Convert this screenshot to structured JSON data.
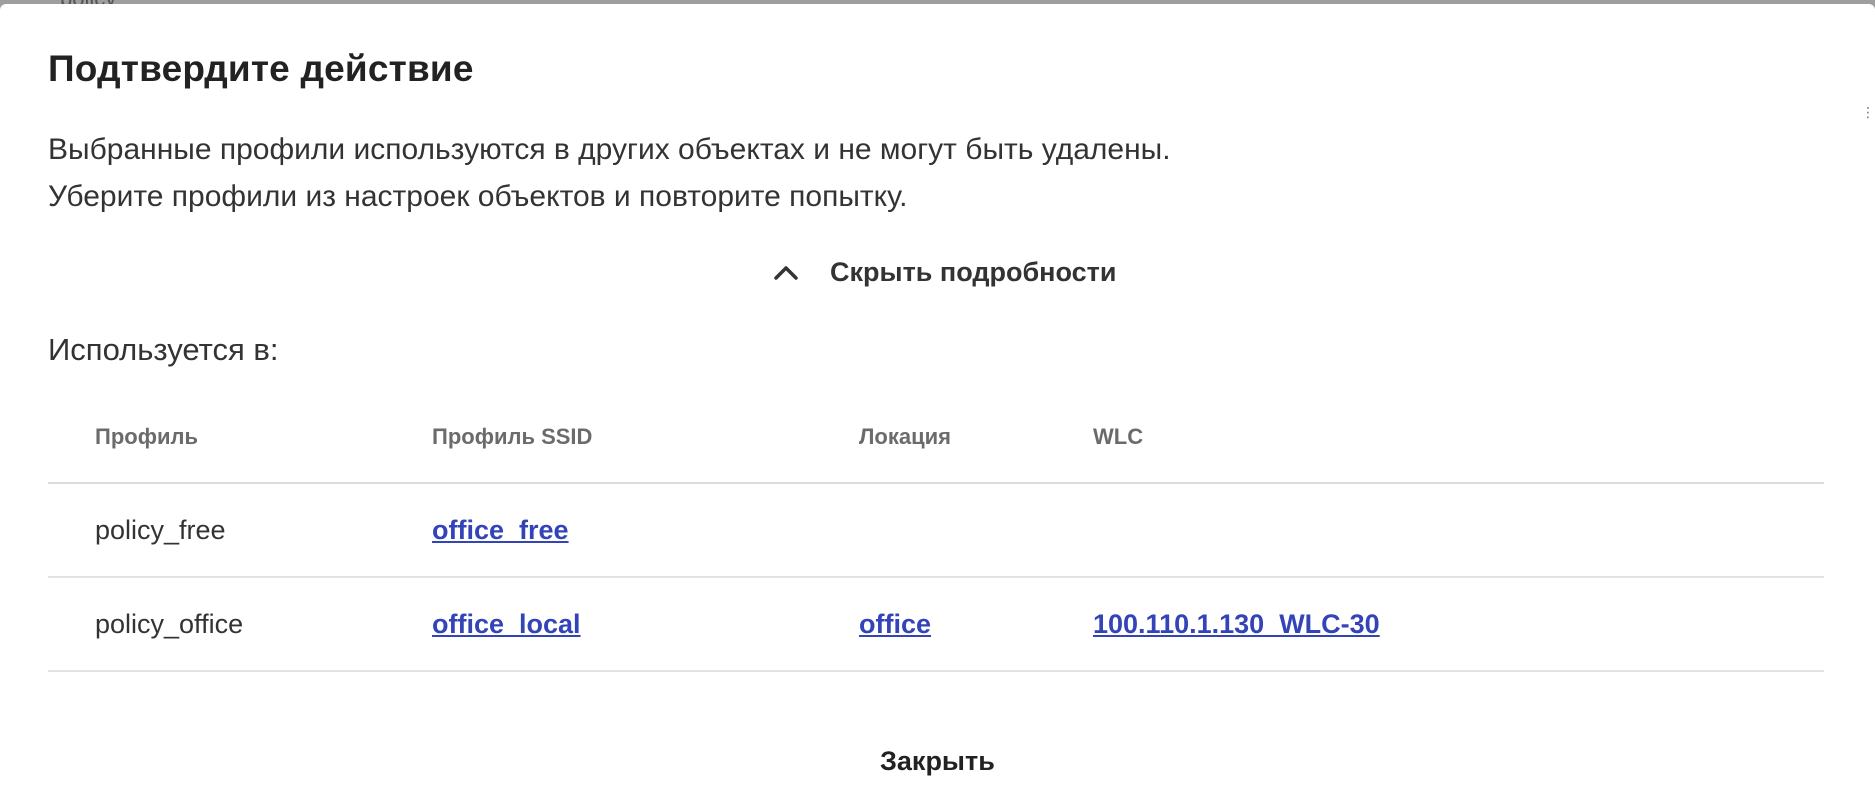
{
  "backdrop": {
    "text": "policy_"
  },
  "dialog": {
    "title": "Подтвердите действие",
    "message_line1": "Выбранные профили используются в других объектах и не могут быть удалены.",
    "message_line2": "Уберите профили из настроек объектов и повторите попытку.",
    "toggle_label": "Скрыть подробности",
    "toggle_icon": "chevron-up-icon",
    "used_in_label": "Используется в:",
    "table": {
      "headers": [
        "Профиль",
        "Профиль SSID",
        "Локация",
        "WLC"
      ],
      "rows": [
        {
          "profile": "policy_free",
          "ssid_profile": "office_free",
          "location": "",
          "wlc": ""
        },
        {
          "profile": "policy_office",
          "ssid_profile": "office_local",
          "location": "office",
          "wlc": "100.110.1.130_WLC-30"
        }
      ]
    },
    "close_label": "Закрыть"
  },
  "colors": {
    "link": "#3343b8",
    "text": "#333333",
    "header_text": "#6b6b6b",
    "divider": "#dcdcdc"
  }
}
